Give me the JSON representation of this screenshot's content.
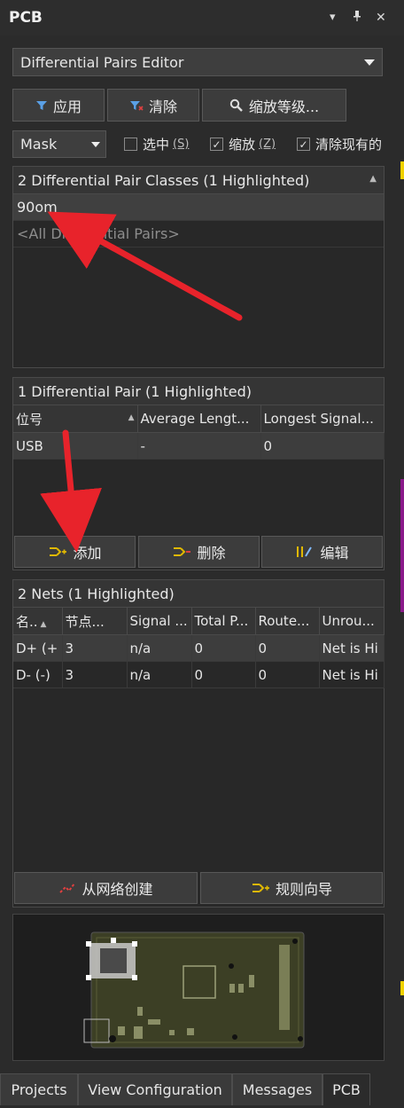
{
  "panel": {
    "title": "PCB"
  },
  "mode_selector": {
    "value": "Differential Pairs Editor"
  },
  "toolbar": {
    "apply": "应用",
    "clear": "清除",
    "zoom_level": "缩放等级..."
  },
  "filter": {
    "mask_value": "Mask",
    "select": {
      "label": "选中",
      "shortcut": "(S)",
      "checked": false
    },
    "zoom": {
      "label": "缩放",
      "shortcut": "(Z)",
      "checked": true
    },
    "clear_existing": {
      "label": "清除现有的",
      "checked": true
    }
  },
  "classes": {
    "header": "2 Differential Pair Classes (1 Highlighted)",
    "items": [
      "90om",
      "<All Differential Pairs>"
    ]
  },
  "pairs": {
    "header": "1 Differential Pair (1 Highlighted)",
    "columns": [
      "位号",
      "Average Lengt...",
      "Longest Signal..."
    ],
    "rows": [
      [
        "USB",
        "-",
        "0"
      ]
    ],
    "add": "添加",
    "delete": "删除",
    "edit": "编辑"
  },
  "nets": {
    "header": "2 Nets (1 Highlighted)",
    "columns": [
      "名..",
      "节点...",
      "Signal ...",
      "Total P...",
      "Route...",
      "Unrou..."
    ],
    "rows": [
      [
        "D+ (+",
        "3",
        "n/a",
        "0",
        "0",
        "Net is Hi"
      ],
      [
        "D- (-)",
        "3",
        "n/a",
        "0",
        "0",
        "Net is Hi"
      ]
    ],
    "create_from_nets": "从网络创建",
    "rule_wizard": "规则向导"
  },
  "tabs": [
    "Projects",
    "View Configuration",
    "Messages",
    "PCB"
  ],
  "colors": {
    "annotation_arrow": "#e8232b",
    "accent_yellow": "#f2d200",
    "accent_purple": "#8a1a8a"
  }
}
